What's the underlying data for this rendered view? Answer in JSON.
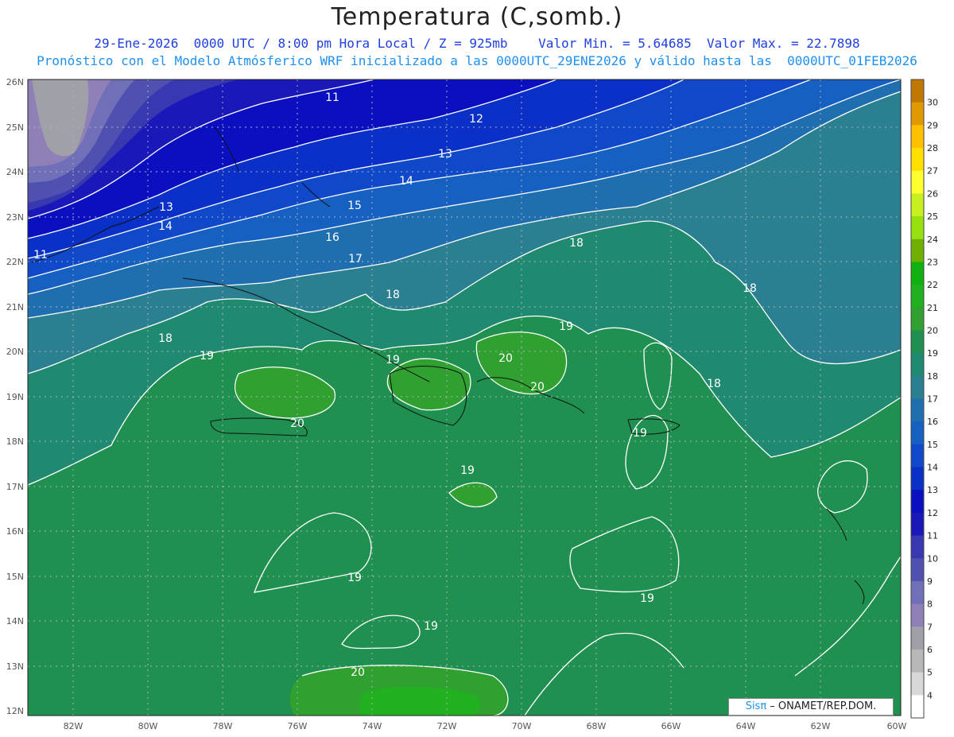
{
  "header": {
    "title": "Temperatura (C,somb.)",
    "line1": "29-Ene-2026  0000 UTC / 8:00 pm Hora Local / Z = 925mb    Valor Min. = 5.64685  Valor Max. = 22.7898",
    "line2": "Pronóstico con el Modelo Atmósferico WRF inicializado a las 0000UTC_29ENE2026 y válido hasta las  0000UTC_01FEB2026"
  },
  "axes": {
    "lat_labels": [
      "26N",
      "25N",
      "24N",
      "23N",
      "22N",
      "21N",
      "20N",
      "19N",
      "18N",
      "17N",
      "16N",
      "15N",
      "14N",
      "13N",
      "12N"
    ],
    "lon_labels": [
      "82W",
      "80W",
      "78W",
      "76W",
      "74W",
      "72W",
      "70W",
      "68W",
      "66W",
      "64W",
      "62W",
      "60W"
    ]
  },
  "colorbar": {
    "labels": [
      "30",
      "29",
      "28",
      "27",
      "26",
      "25",
      "24",
      "23",
      "22",
      "21",
      "20",
      "19",
      "18",
      "17",
      "16",
      "15",
      "14",
      "13",
      "12",
      "11",
      "10",
      "9",
      "8",
      "7",
      "6",
      "5",
      "4"
    ],
    "colors": [
      "#c07800",
      "#e09a00",
      "#ffc000",
      "#ffe000",
      "#ffff30",
      "#c8f020",
      "#98e010",
      "#70b000",
      "#10b010",
      "#20b020",
      "#30a030",
      "#209050",
      "#208a70",
      "#2a8090",
      "#1f6fb0",
      "#1560c0",
      "#0f48c8",
      "#0a30c8",
      "#0a10c0",
      "#1a18b8",
      "#3838b0",
      "#5050b0",
      "#7070b8",
      "#9080b8",
      "#a0a0a8",
      "#b8b8b8",
      "#d8d8d8",
      "#ffffff"
    ]
  },
  "contour_labels": [
    {
      "text": "11"
    },
    {
      "text": "12"
    },
    {
      "text": "13"
    },
    {
      "text": "14"
    },
    {
      "text": "15"
    },
    {
      "text": "16"
    },
    {
      "text": "17"
    },
    {
      "text": "18"
    },
    {
      "text": "18"
    },
    {
      "text": "18"
    },
    {
      "text": "18"
    },
    {
      "text": "18"
    },
    {
      "text": "19"
    },
    {
      "text": "19"
    },
    {
      "text": "19"
    },
    {
      "text": "19"
    },
    {
      "text": "19"
    },
    {
      "text": "19"
    },
    {
      "text": "19"
    },
    {
      "text": "19"
    },
    {
      "text": "20"
    },
    {
      "text": "20"
    },
    {
      "text": "20"
    },
    {
      "text": "20"
    },
    {
      "text": "13"
    },
    {
      "text": "14"
    },
    {
      "text": "11"
    }
  ],
  "credit": {
    "sis": "Sisπ",
    "org": " – ONAMET/REP.DOM."
  }
}
